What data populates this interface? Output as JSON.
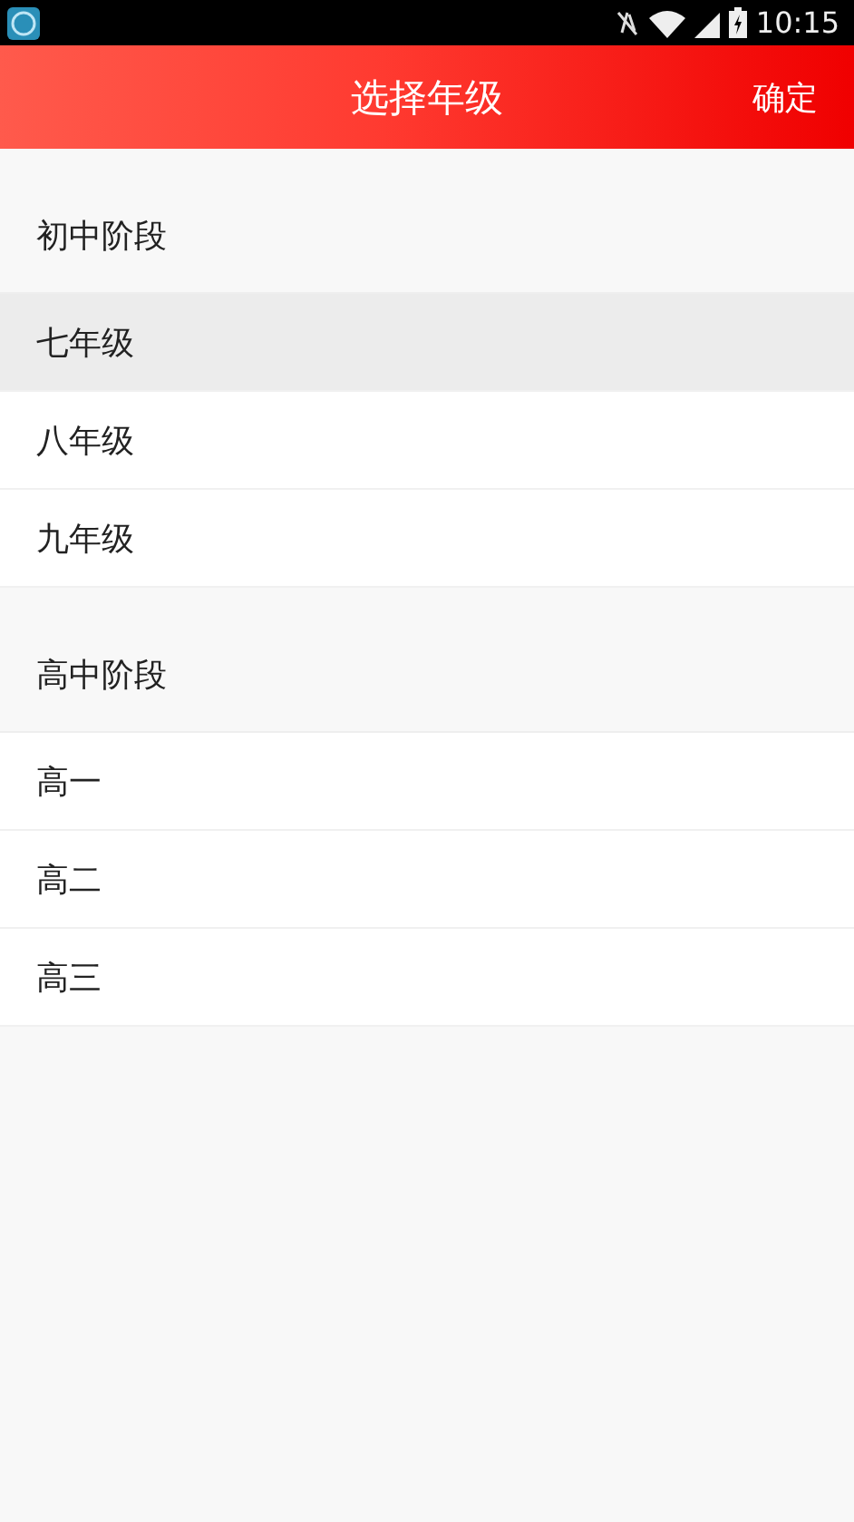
{
  "status_bar": {
    "time": "10:15"
  },
  "header": {
    "title": "选择年级",
    "action": "确定"
  },
  "sections": [
    {
      "heading": "初中阶段",
      "items": [
        {
          "label": "七年级",
          "selected": true
        },
        {
          "label": "八年级",
          "selected": false
        },
        {
          "label": "九年级",
          "selected": false
        }
      ]
    },
    {
      "heading": "高中阶段",
      "items": [
        {
          "label": "高一",
          "selected": false
        },
        {
          "label": "高二",
          "selected": false
        },
        {
          "label": "高三",
          "selected": false
        }
      ]
    }
  ]
}
